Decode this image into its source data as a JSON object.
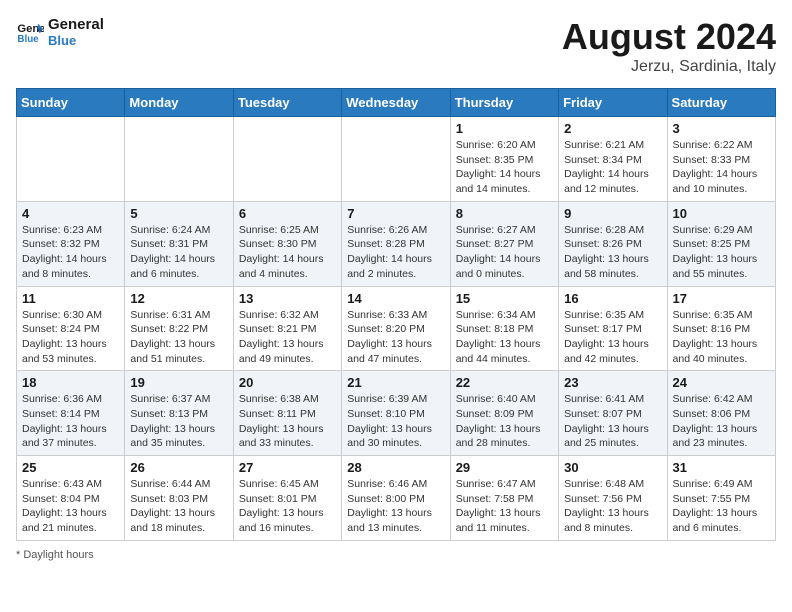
{
  "header": {
    "logo_line1": "General",
    "logo_line2": "Blue",
    "month_title": "August 2024",
    "location": "Jerzu, Sardinia, Italy"
  },
  "days_of_week": [
    "Sunday",
    "Monday",
    "Tuesday",
    "Wednesday",
    "Thursday",
    "Friday",
    "Saturday"
  ],
  "footer": {
    "note": "Daylight hours"
  },
  "weeks": [
    [
      {
        "day": "",
        "detail": ""
      },
      {
        "day": "",
        "detail": ""
      },
      {
        "day": "",
        "detail": ""
      },
      {
        "day": "",
        "detail": ""
      },
      {
        "day": "1",
        "detail": "Sunrise: 6:20 AM\nSunset: 8:35 PM\nDaylight: 14 hours\nand 14 minutes."
      },
      {
        "day": "2",
        "detail": "Sunrise: 6:21 AM\nSunset: 8:34 PM\nDaylight: 14 hours\nand 12 minutes."
      },
      {
        "day": "3",
        "detail": "Sunrise: 6:22 AM\nSunset: 8:33 PM\nDaylight: 14 hours\nand 10 minutes."
      }
    ],
    [
      {
        "day": "4",
        "detail": "Sunrise: 6:23 AM\nSunset: 8:32 PM\nDaylight: 14 hours\nand 8 minutes."
      },
      {
        "day": "5",
        "detail": "Sunrise: 6:24 AM\nSunset: 8:31 PM\nDaylight: 14 hours\nand 6 minutes."
      },
      {
        "day": "6",
        "detail": "Sunrise: 6:25 AM\nSunset: 8:30 PM\nDaylight: 14 hours\nand 4 minutes."
      },
      {
        "day": "7",
        "detail": "Sunrise: 6:26 AM\nSunset: 8:28 PM\nDaylight: 14 hours\nand 2 minutes."
      },
      {
        "day": "8",
        "detail": "Sunrise: 6:27 AM\nSunset: 8:27 PM\nDaylight: 14 hours\nand 0 minutes."
      },
      {
        "day": "9",
        "detail": "Sunrise: 6:28 AM\nSunset: 8:26 PM\nDaylight: 13 hours\nand 58 minutes."
      },
      {
        "day": "10",
        "detail": "Sunrise: 6:29 AM\nSunset: 8:25 PM\nDaylight: 13 hours\nand 55 minutes."
      }
    ],
    [
      {
        "day": "11",
        "detail": "Sunrise: 6:30 AM\nSunset: 8:24 PM\nDaylight: 13 hours\nand 53 minutes."
      },
      {
        "day": "12",
        "detail": "Sunrise: 6:31 AM\nSunset: 8:22 PM\nDaylight: 13 hours\nand 51 minutes."
      },
      {
        "day": "13",
        "detail": "Sunrise: 6:32 AM\nSunset: 8:21 PM\nDaylight: 13 hours\nand 49 minutes."
      },
      {
        "day": "14",
        "detail": "Sunrise: 6:33 AM\nSunset: 8:20 PM\nDaylight: 13 hours\nand 47 minutes."
      },
      {
        "day": "15",
        "detail": "Sunrise: 6:34 AM\nSunset: 8:18 PM\nDaylight: 13 hours\nand 44 minutes."
      },
      {
        "day": "16",
        "detail": "Sunrise: 6:35 AM\nSunset: 8:17 PM\nDaylight: 13 hours\nand 42 minutes."
      },
      {
        "day": "17",
        "detail": "Sunrise: 6:35 AM\nSunset: 8:16 PM\nDaylight: 13 hours\nand 40 minutes."
      }
    ],
    [
      {
        "day": "18",
        "detail": "Sunrise: 6:36 AM\nSunset: 8:14 PM\nDaylight: 13 hours\nand 37 minutes."
      },
      {
        "day": "19",
        "detail": "Sunrise: 6:37 AM\nSunset: 8:13 PM\nDaylight: 13 hours\nand 35 minutes."
      },
      {
        "day": "20",
        "detail": "Sunrise: 6:38 AM\nSunset: 8:11 PM\nDaylight: 13 hours\nand 33 minutes."
      },
      {
        "day": "21",
        "detail": "Sunrise: 6:39 AM\nSunset: 8:10 PM\nDaylight: 13 hours\nand 30 minutes."
      },
      {
        "day": "22",
        "detail": "Sunrise: 6:40 AM\nSunset: 8:09 PM\nDaylight: 13 hours\nand 28 minutes."
      },
      {
        "day": "23",
        "detail": "Sunrise: 6:41 AM\nSunset: 8:07 PM\nDaylight: 13 hours\nand 25 minutes."
      },
      {
        "day": "24",
        "detail": "Sunrise: 6:42 AM\nSunset: 8:06 PM\nDaylight: 13 hours\nand 23 minutes."
      }
    ],
    [
      {
        "day": "25",
        "detail": "Sunrise: 6:43 AM\nSunset: 8:04 PM\nDaylight: 13 hours\nand 21 minutes."
      },
      {
        "day": "26",
        "detail": "Sunrise: 6:44 AM\nSunset: 8:03 PM\nDaylight: 13 hours\nand 18 minutes."
      },
      {
        "day": "27",
        "detail": "Sunrise: 6:45 AM\nSunset: 8:01 PM\nDaylight: 13 hours\nand 16 minutes."
      },
      {
        "day": "28",
        "detail": "Sunrise: 6:46 AM\nSunset: 8:00 PM\nDaylight: 13 hours\nand 13 minutes."
      },
      {
        "day": "29",
        "detail": "Sunrise: 6:47 AM\nSunset: 7:58 PM\nDaylight: 13 hours\nand 11 minutes."
      },
      {
        "day": "30",
        "detail": "Sunrise: 6:48 AM\nSunset: 7:56 PM\nDaylight: 13 hours\nand 8 minutes."
      },
      {
        "day": "31",
        "detail": "Sunrise: 6:49 AM\nSunset: 7:55 PM\nDaylight: 13 hours\nand 6 minutes."
      }
    ]
  ]
}
